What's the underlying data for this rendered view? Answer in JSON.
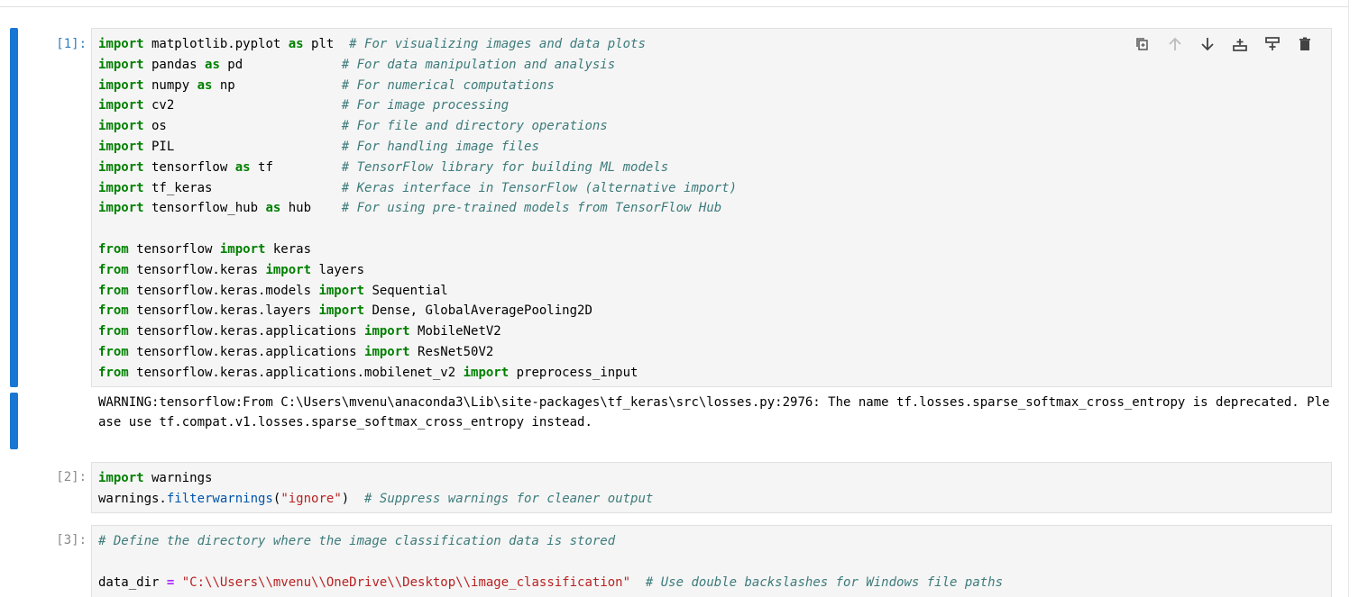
{
  "cells": [
    {
      "prompt": "[1]:",
      "active": true,
      "lines": [
        "import matplotlib.pyplot as plt  # For visualizing images and data plots",
        "import pandas as pd             # For data manipulation and analysis",
        "import numpy as np              # For numerical computations",
        "import cv2                      # For image processing",
        "import os                       # For file and directory operations",
        "import PIL                      # For handling image files",
        "import tensorflow as tf         # TensorFlow library for building ML models",
        "import tf_keras                 # Keras interface in TensorFlow (alternative import)",
        "import tensorflow_hub as hub    # For using pre-trained models from TensorFlow Hub",
        "",
        "from tensorflow import keras",
        "from tensorflow.keras import layers",
        "from tensorflow.keras.models import Sequential",
        "from tensorflow.keras.layers import Dense, GlobalAveragePooling2D",
        "from tensorflow.keras.applications import MobileNetV2",
        "from tensorflow.keras.applications import ResNet50V2",
        "from tensorflow.keras.applications.mobilenet_v2 import preprocess_input"
      ],
      "output": "WARNING:tensorflow:From C:\\Users\\mvenu\\anaconda3\\Lib\\site-packages\\tf_keras\\src\\losses.py:2976: The name tf.losses.sparse_softmax_cross_entropy is deprecated. Please use tf.compat.v1.losses.sparse_softmax_cross_entropy instead."
    },
    {
      "prompt": "[2]:",
      "active": false,
      "lines": [
        "import warnings",
        "warnings.filterwarnings(\"ignore\")  # Suppress warnings for cleaner output"
      ]
    },
    {
      "prompt": "[3]:",
      "active": false,
      "lines": [
        "# Define the directory where the image classification data is stored",
        "",
        "data_dir = \"C:\\\\Users\\\\mvenu\\\\OneDrive\\\\Desktop\\\\image_classification\"  # Use double backslashes for Windows file paths"
      ]
    }
  ],
  "toolbar": [
    {
      "name": "duplicate-cell",
      "icon": "copy-icon"
    },
    {
      "name": "move-cell-up",
      "icon": "arrow-up-icon"
    },
    {
      "name": "move-cell-down",
      "icon": "arrow-down-icon"
    },
    {
      "name": "insert-cell-above",
      "icon": "insert-above-icon"
    },
    {
      "name": "insert-cell-below",
      "icon": "insert-below-icon"
    },
    {
      "name": "delete-cell",
      "icon": "trash-icon"
    }
  ],
  "colors": {
    "active_bar": "#1976d2",
    "keyword": "#008000",
    "comment": "#3d7b7b",
    "string": "#ba2121",
    "function": "#0055aa",
    "operator": "#aa22ff"
  }
}
